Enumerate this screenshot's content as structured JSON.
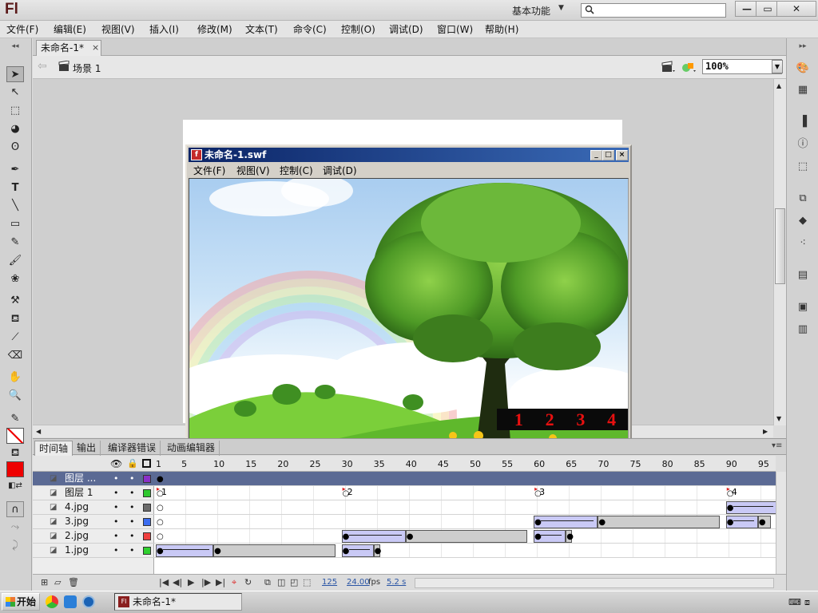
{
  "app": {
    "logo": "Fl",
    "workspace": "基本功能",
    "search_placeholder": ""
  },
  "window_controls": {
    "minimize": "—",
    "restore": "▭",
    "close": "✕"
  },
  "menu": [
    "文件(F)",
    "编辑(E)",
    "视图(V)",
    "插入(I)",
    "修改(M)",
    "文本(T)",
    "命令(C)",
    "控制(O)",
    "调试(D)",
    "窗口(W)",
    "帮助(H)"
  ],
  "document": {
    "tab": "未命名-1*",
    "close": "×",
    "scene": "场景 1",
    "zoom": "100%"
  },
  "swf": {
    "title": "未命名-1.swf",
    "menu": [
      "文件(F)",
      "视图(V)",
      "控制(C)",
      "调试(D)"
    ],
    "buttons": [
      "1",
      "2",
      "3",
      "4"
    ]
  },
  "timeline": {
    "tabs": [
      "时间轴",
      "输出",
      "编译器错误",
      "动画编辑器"
    ],
    "ruler": [
      "1",
      "5",
      "10",
      "15",
      "20",
      "25",
      "30",
      "35",
      "40",
      "45",
      "50",
      "55",
      "60",
      "65",
      "70",
      "75",
      "80",
      "85",
      "90",
      "95"
    ],
    "layers": [
      {
        "name": "图层 ...",
        "color": "#8a2fc8",
        "active": true
      },
      {
        "name": "图层 1",
        "color": "#2fc82f",
        "active": false
      },
      {
        "name": "4.jpg",
        "color": "#6a6a6a",
        "active": false
      },
      {
        "name": "3.jpg",
        "color": "#3a6cf0",
        "active": false
      },
      {
        "name": "2.jpg",
        "color": "#f04040",
        "active": false
      },
      {
        "name": "1.jpg",
        "color": "#2fd02f",
        "active": false
      }
    ],
    "frame_labels": [
      "1",
      "2",
      "3",
      "4"
    ],
    "current_frame": "125",
    "fps": "24.00",
    "fps_unit": "fps",
    "elapsed": "5.2 s"
  },
  "taskbar": {
    "start": "开始",
    "task": "未命名-1*"
  }
}
